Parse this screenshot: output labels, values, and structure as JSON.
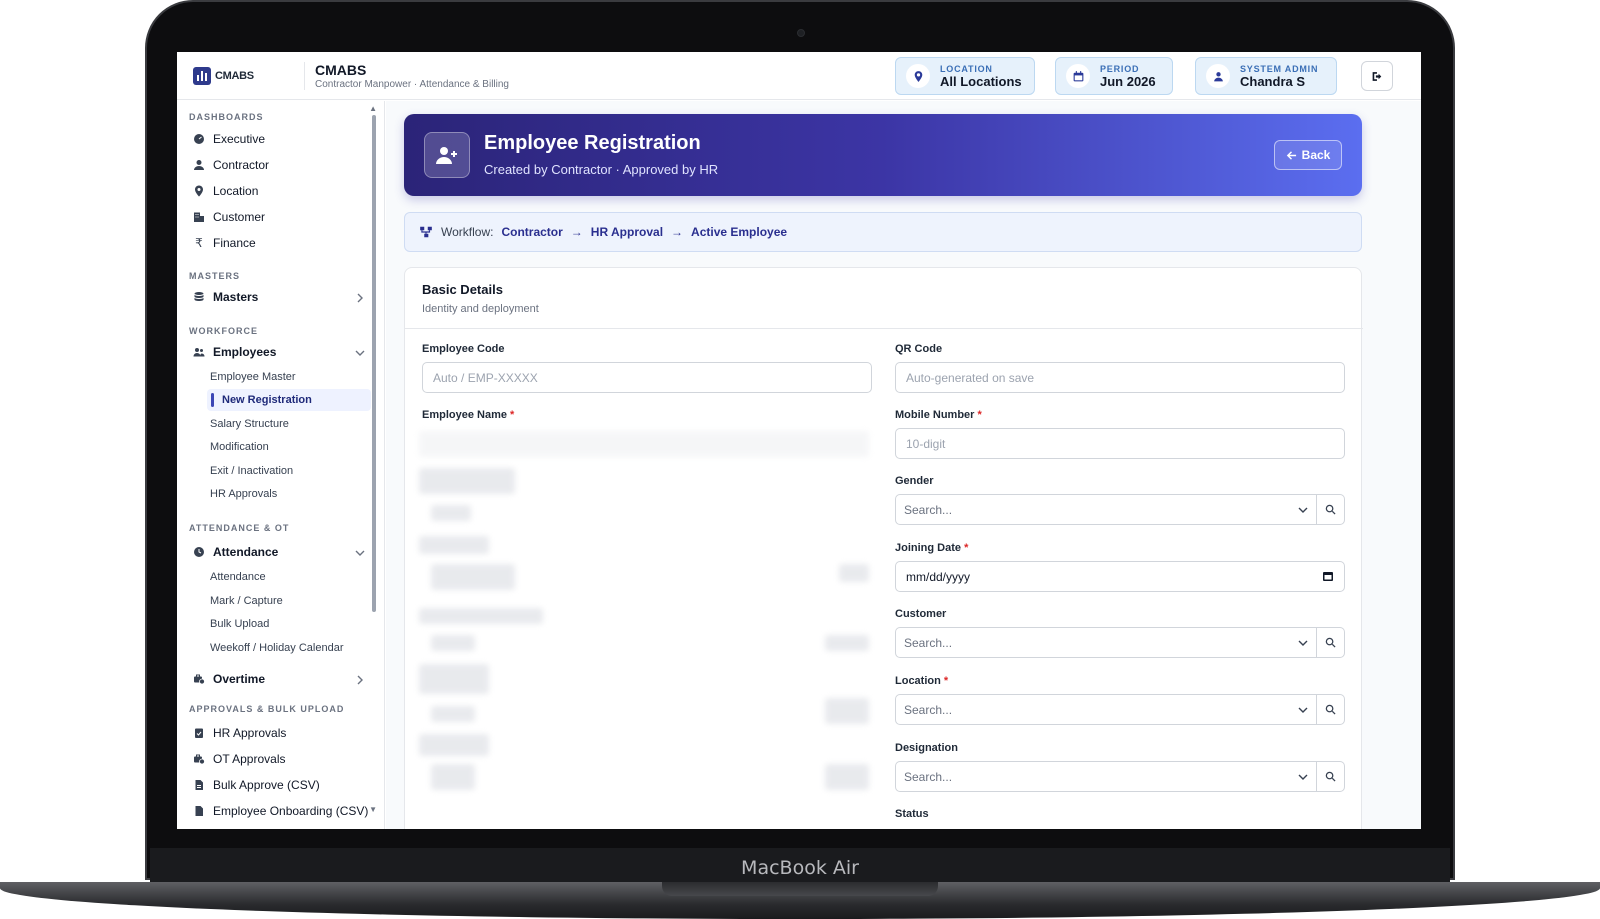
{
  "device": {
    "label": "MacBook Air"
  },
  "header": {
    "logo_text": "CMABS",
    "title": "CMABS",
    "subtitle": "Contractor Manpower · Attendance & Billing",
    "location": {
      "label": "LOCATION",
      "value": "All Locations"
    },
    "period": {
      "label": "PERIOD",
      "value": "Jun 2026"
    },
    "user": {
      "label": "SYSTEM ADMIN",
      "value": "Chandra S"
    }
  },
  "sidebar": {
    "sections": {
      "dashboards": "DASHBOARDS",
      "masters": "MASTERS",
      "workforce": "WORKFORCE",
      "attendance": "ATTENDANCE & OT",
      "approvals": "APPROVALS & BULK UPLOAD"
    },
    "dashboards": [
      "Executive",
      "Contractor",
      "Location",
      "Customer",
      "Finance"
    ],
    "masters_group": "Masters",
    "employees_group": "Employees",
    "employees_items": [
      "Employee Master",
      "New Registration",
      "Salary Structure",
      "Modification",
      "Exit / Inactivation",
      "HR Approvals"
    ],
    "attendance_group": "Attendance",
    "attendance_items": [
      "Attendance",
      "Mark / Capture",
      "Bulk Upload",
      "Weekoff / Holiday Calendar"
    ],
    "overtime_group": "Overtime",
    "approvals_items": [
      "HR Approvals",
      "OT Approvals",
      "Bulk Approve (CSV)",
      "Employee Onboarding (CSV)"
    ]
  },
  "hero": {
    "title": "Employee Registration",
    "subtitle": "Created by Contractor · Approved by HR",
    "back_label": "Back"
  },
  "workflow": {
    "label": "Workflow:",
    "steps": [
      "Contractor",
      "HR Approval",
      "Active Employee"
    ],
    "arrow": "→"
  },
  "form": {
    "section_title": "Basic Details",
    "section_subtitle": "Identity and deployment",
    "employee_code": {
      "label": "Employee Code",
      "placeholder": "Auto / EMP-XXXXX"
    },
    "qr_code": {
      "label": "QR Code",
      "placeholder": "Auto-generated on save"
    },
    "employee_name": {
      "label": "Employee Name"
    },
    "mobile": {
      "label": "Mobile Number",
      "placeholder": "10-digit"
    },
    "gender": {
      "label": "Gender",
      "placeholder": "Search..."
    },
    "joining_date": {
      "label": "Joining Date",
      "value": "mm/dd/yyyy"
    },
    "customer": {
      "label": "Customer",
      "placeholder": "Search..."
    },
    "location": {
      "label": "Location",
      "placeholder": "Search..."
    },
    "designation": {
      "label": "Designation",
      "placeholder": "Search..."
    },
    "status": {
      "label": "Status"
    },
    "required_mark": "*"
  },
  "help": {
    "label": "?"
  }
}
